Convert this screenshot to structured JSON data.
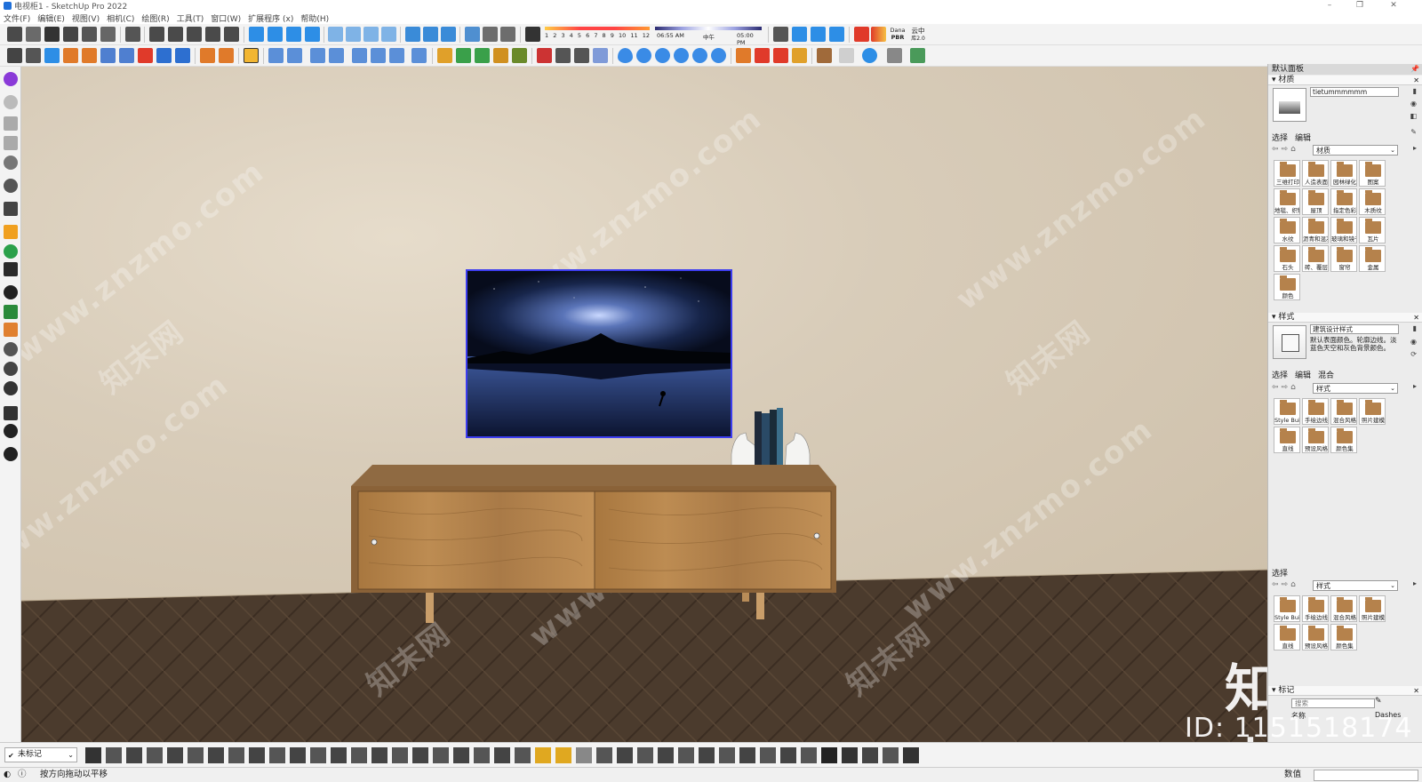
{
  "window": {
    "title": "电视柜1 - SketchUp Pro 2022",
    "controls": [
      "–",
      "❐",
      "✕"
    ]
  },
  "menu": [
    "文件(F)",
    "编辑(E)",
    "视图(V)",
    "相机(C)",
    "绘图(R)",
    "工具(T)",
    "窗口(W)",
    "扩展程序 (x)",
    "帮助(H)"
  ],
  "shadow_panel": {
    "months": [
      "1",
      "2",
      "3",
      "4",
      "5",
      "6",
      "7",
      "8",
      "9",
      "10",
      "11",
      "12"
    ],
    "time_start": "06:55 AM",
    "time_mid": "中午",
    "time_end": "05:00 PM"
  },
  "toolbar_labels": {
    "pbr": "PBR",
    "enscape": "Dana",
    "cloud_lib": "云中",
    "cloud_lib2": "库2.0"
  },
  "tray": {
    "title": "默认面板",
    "materials": {
      "header": "材质",
      "name_field": "tietummmmmm",
      "tabs": [
        "选择",
        "编辑"
      ],
      "dropdown": "材质",
      "items": [
        "三维打印",
        "人造表面",
        "园林绿化",
        "图案",
        "地毯、织物",
        "屋顶",
        "指定色彩",
        "木质纹",
        "水纹",
        "沥青和混凝土",
        "玻璃和镜子",
        "瓦片",
        "石头",
        "砖、覆层",
        "窗帘",
        "金属",
        "颜色"
      ]
    },
    "styles": {
      "header": "样式",
      "name_field": "建筑设计样式",
      "description": "默认表面颜色。轮廓边线。淡蓝色天空和灰色背景颜色。",
      "tabs": [
        "选择",
        "编辑",
        "混合"
      ],
      "dropdown": "样式",
      "items": [
        "Style Builder",
        "手绘边线",
        "混合风格",
        "照片建模",
        "直线",
        "预设风格",
        "颜色集"
      ]
    },
    "styles2": {
      "tab": "选择",
      "dropdown": "样式",
      "items": [
        "Style Builder",
        "手绘边线",
        "混合风格",
        "照片建模",
        "直线",
        "预设风格",
        "颜色集"
      ]
    },
    "layers": {
      "header": "标记",
      "search_placeholder": "搜索",
      "col_name": "名称",
      "col_dashes": "Dashes"
    }
  },
  "watermarks": {
    "site": "www.znzmo.com",
    "logo": "知末",
    "id": "ID: 1151518174",
    "brand_cn": "知末网"
  },
  "bottom_toolbar": {
    "layer_dropdown": "未标记"
  },
  "status": {
    "text": "按方向拖动以平移",
    "measurements_label": "数值"
  },
  "colors": {
    "tv_border": "#3d3df0",
    "wall": "#d8ccb9",
    "floor": "#4a3a2c",
    "cabinet_wood": "#a97a47",
    "sketchup_blue": "#1e6fd9"
  }
}
